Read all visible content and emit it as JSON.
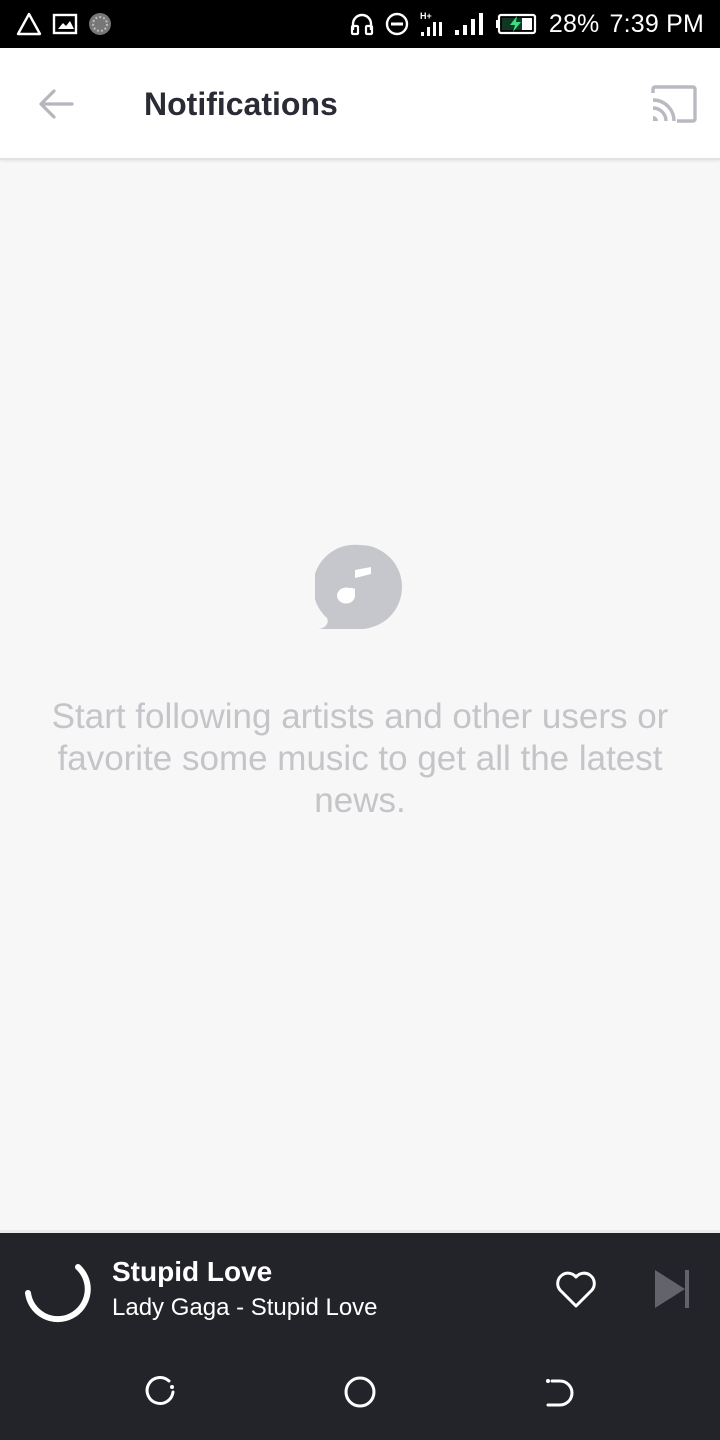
{
  "status_bar": {
    "battery_percent": "28%",
    "time": "7:39 PM",
    "left_icons": [
      "warning-icon",
      "screenshot-icon",
      "loading-icon"
    ],
    "right_icons": [
      "headphones-icon",
      "do-not-disturb-icon",
      "data-hplus-icon",
      "signal-icon",
      "battery-charging-icon"
    ],
    "battery_color": "#3ddc84"
  },
  "header": {
    "title": "Notifications",
    "back_icon": "arrow-left-icon",
    "cast_icon": "cast-icon"
  },
  "empty_state": {
    "icon": "music-note-bubble-icon",
    "message": "Start following artists and other users or favorite some music to get all the latest news."
  },
  "mini_player": {
    "title": "Stupid Love",
    "subtitle": "Lady Gaga - Stupid Love",
    "favorite_icon": "heart-outline-icon",
    "next_icon": "skip-next-icon",
    "loading_icon": "spinner-icon"
  },
  "nav_bar": {
    "icons": [
      "recent-apps-icon",
      "home-icon",
      "back-icon"
    ]
  },
  "colors": {
    "background": "#f7f7f7",
    "app_bar": "#ffffff",
    "player": "#23232a",
    "title_text": "#2b2b36",
    "muted_text": "#c4c4c9",
    "icon_grey": "#b9b9c1"
  }
}
